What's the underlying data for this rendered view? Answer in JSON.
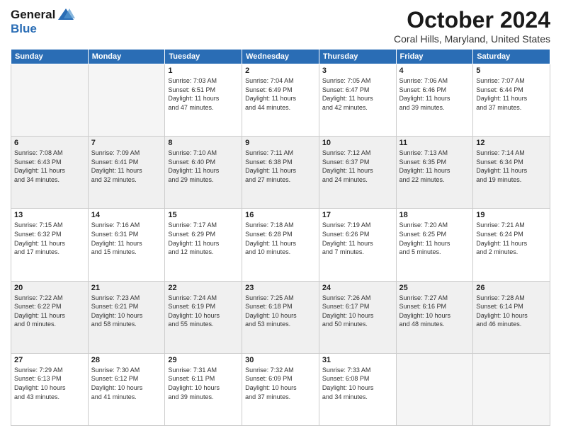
{
  "logo": {
    "line1": "General",
    "line2": "Blue"
  },
  "title": "October 2024",
  "location": "Coral Hills, Maryland, United States",
  "weekdays": [
    "Sunday",
    "Monday",
    "Tuesday",
    "Wednesday",
    "Thursday",
    "Friday",
    "Saturday"
  ],
  "weeks": [
    [
      {
        "day": "",
        "info": ""
      },
      {
        "day": "",
        "info": ""
      },
      {
        "day": "1",
        "info": "Sunrise: 7:03 AM\nSunset: 6:51 PM\nDaylight: 11 hours\nand 47 minutes."
      },
      {
        "day": "2",
        "info": "Sunrise: 7:04 AM\nSunset: 6:49 PM\nDaylight: 11 hours\nand 44 minutes."
      },
      {
        "day": "3",
        "info": "Sunrise: 7:05 AM\nSunset: 6:47 PM\nDaylight: 11 hours\nand 42 minutes."
      },
      {
        "day": "4",
        "info": "Sunrise: 7:06 AM\nSunset: 6:46 PM\nDaylight: 11 hours\nand 39 minutes."
      },
      {
        "day": "5",
        "info": "Sunrise: 7:07 AM\nSunset: 6:44 PM\nDaylight: 11 hours\nand 37 minutes."
      }
    ],
    [
      {
        "day": "6",
        "info": "Sunrise: 7:08 AM\nSunset: 6:43 PM\nDaylight: 11 hours\nand 34 minutes."
      },
      {
        "day": "7",
        "info": "Sunrise: 7:09 AM\nSunset: 6:41 PM\nDaylight: 11 hours\nand 32 minutes."
      },
      {
        "day": "8",
        "info": "Sunrise: 7:10 AM\nSunset: 6:40 PM\nDaylight: 11 hours\nand 29 minutes."
      },
      {
        "day": "9",
        "info": "Sunrise: 7:11 AM\nSunset: 6:38 PM\nDaylight: 11 hours\nand 27 minutes."
      },
      {
        "day": "10",
        "info": "Sunrise: 7:12 AM\nSunset: 6:37 PM\nDaylight: 11 hours\nand 24 minutes."
      },
      {
        "day": "11",
        "info": "Sunrise: 7:13 AM\nSunset: 6:35 PM\nDaylight: 11 hours\nand 22 minutes."
      },
      {
        "day": "12",
        "info": "Sunrise: 7:14 AM\nSunset: 6:34 PM\nDaylight: 11 hours\nand 19 minutes."
      }
    ],
    [
      {
        "day": "13",
        "info": "Sunrise: 7:15 AM\nSunset: 6:32 PM\nDaylight: 11 hours\nand 17 minutes."
      },
      {
        "day": "14",
        "info": "Sunrise: 7:16 AM\nSunset: 6:31 PM\nDaylight: 11 hours\nand 15 minutes."
      },
      {
        "day": "15",
        "info": "Sunrise: 7:17 AM\nSunset: 6:29 PM\nDaylight: 11 hours\nand 12 minutes."
      },
      {
        "day": "16",
        "info": "Sunrise: 7:18 AM\nSunset: 6:28 PM\nDaylight: 11 hours\nand 10 minutes."
      },
      {
        "day": "17",
        "info": "Sunrise: 7:19 AM\nSunset: 6:26 PM\nDaylight: 11 hours\nand 7 minutes."
      },
      {
        "day": "18",
        "info": "Sunrise: 7:20 AM\nSunset: 6:25 PM\nDaylight: 11 hours\nand 5 minutes."
      },
      {
        "day": "19",
        "info": "Sunrise: 7:21 AM\nSunset: 6:24 PM\nDaylight: 11 hours\nand 2 minutes."
      }
    ],
    [
      {
        "day": "20",
        "info": "Sunrise: 7:22 AM\nSunset: 6:22 PM\nDaylight: 11 hours\nand 0 minutes."
      },
      {
        "day": "21",
        "info": "Sunrise: 7:23 AM\nSunset: 6:21 PM\nDaylight: 10 hours\nand 58 minutes."
      },
      {
        "day": "22",
        "info": "Sunrise: 7:24 AM\nSunset: 6:19 PM\nDaylight: 10 hours\nand 55 minutes."
      },
      {
        "day": "23",
        "info": "Sunrise: 7:25 AM\nSunset: 6:18 PM\nDaylight: 10 hours\nand 53 minutes."
      },
      {
        "day": "24",
        "info": "Sunrise: 7:26 AM\nSunset: 6:17 PM\nDaylight: 10 hours\nand 50 minutes."
      },
      {
        "day": "25",
        "info": "Sunrise: 7:27 AM\nSunset: 6:16 PM\nDaylight: 10 hours\nand 48 minutes."
      },
      {
        "day": "26",
        "info": "Sunrise: 7:28 AM\nSunset: 6:14 PM\nDaylight: 10 hours\nand 46 minutes."
      }
    ],
    [
      {
        "day": "27",
        "info": "Sunrise: 7:29 AM\nSunset: 6:13 PM\nDaylight: 10 hours\nand 43 minutes."
      },
      {
        "day": "28",
        "info": "Sunrise: 7:30 AM\nSunset: 6:12 PM\nDaylight: 10 hours\nand 41 minutes."
      },
      {
        "day": "29",
        "info": "Sunrise: 7:31 AM\nSunset: 6:11 PM\nDaylight: 10 hours\nand 39 minutes."
      },
      {
        "day": "30",
        "info": "Sunrise: 7:32 AM\nSunset: 6:09 PM\nDaylight: 10 hours\nand 37 minutes."
      },
      {
        "day": "31",
        "info": "Sunrise: 7:33 AM\nSunset: 6:08 PM\nDaylight: 10 hours\nand 34 minutes."
      },
      {
        "day": "",
        "info": ""
      },
      {
        "day": "",
        "info": ""
      }
    ]
  ]
}
